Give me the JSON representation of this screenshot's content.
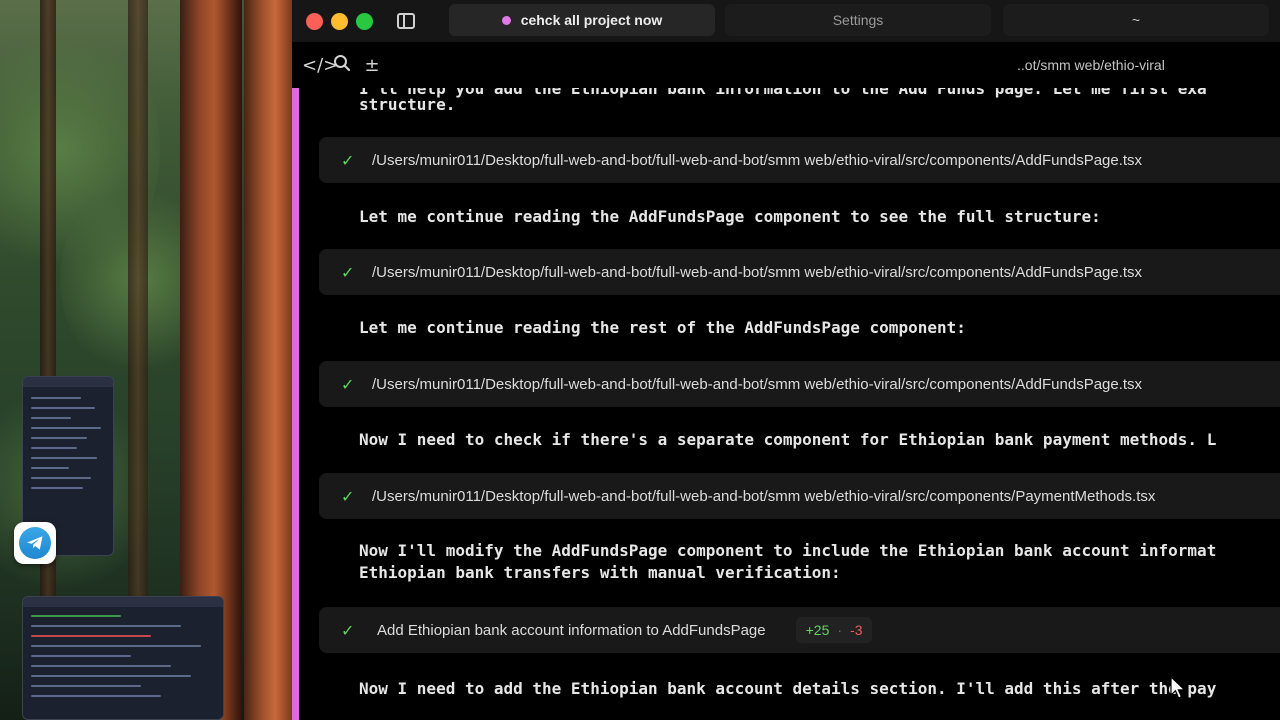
{
  "app": {
    "tabs": [
      {
        "label": "cehck all project now",
        "active": true,
        "dot_color": "#e07ae6"
      },
      {
        "label": "Settings",
        "active": false
      },
      {
        "label": "~",
        "active": false
      }
    ],
    "toolbar": {
      "icons": [
        "code-icon",
        "search-icon",
        "plus-minus-icon"
      ],
      "path": "..ot/smm web/ethio-viral"
    }
  },
  "conversation": {
    "lines": [
      {
        "type": "text",
        "text": "I'll help you add the Ethiopian bank information to the Add Funds page. Let me first exa"
      },
      {
        "type": "text",
        "text": "structure."
      },
      {
        "type": "tool",
        "status": "done",
        "text": "/Users/munir011/Desktop/full-web-and-bot/full-web-and-bot/smm web/ethio-viral/src/components/AddFundsPage.tsx"
      },
      {
        "type": "text",
        "text": "Let me continue reading the AddFundsPage component to see the full structure:"
      },
      {
        "type": "tool",
        "status": "done",
        "text": "/Users/munir011/Desktop/full-web-and-bot/full-web-and-bot/smm web/ethio-viral/src/components/AddFundsPage.tsx"
      },
      {
        "type": "text",
        "text": "Let me continue reading the rest of the AddFundsPage component:"
      },
      {
        "type": "tool",
        "status": "done",
        "text": "/Users/munir011/Desktop/full-web-and-bot/full-web-and-bot/smm web/ethio-viral/src/components/AddFundsPage.tsx"
      },
      {
        "type": "text",
        "text": "Now I need to check if there's a separate component for Ethiopian bank payment methods. L"
      },
      {
        "type": "tool",
        "status": "done",
        "text": "/Users/munir011/Desktop/full-web-and-bot/full-web-and-bot/smm web/ethio-viral/src/components/PaymentMethods.tsx"
      },
      {
        "type": "text",
        "text": "Now I'll modify the AddFundsPage component to include the Ethiopian bank account informat"
      },
      {
        "type": "text",
        "text": "Ethiopian bank transfers with manual verification:"
      },
      {
        "type": "edit",
        "status": "done",
        "text": "Add Ethiopian bank account information to AddFundsPage",
        "additions": "+25",
        "separator": "·",
        "deletions": "-3"
      },
      {
        "type": "text",
        "text": "Now I need to add the Ethiopian bank account details section. I'll add this after the pay"
      }
    ]
  },
  "colors": {
    "accent": "#dd6ae0",
    "check": "#5fd35f",
    "additions": "#63d463",
    "deletions": "#ee5a5a"
  }
}
